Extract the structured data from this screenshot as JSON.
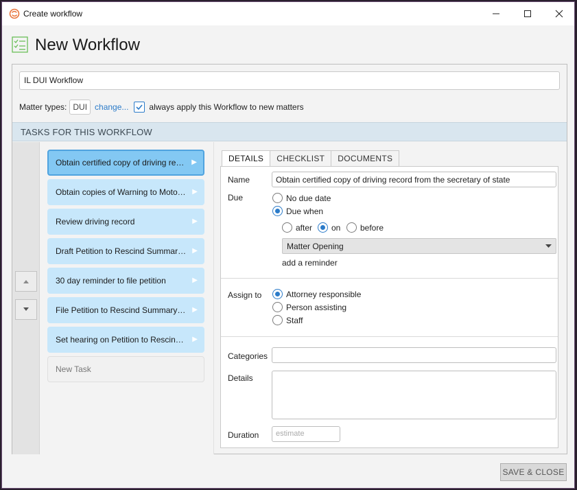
{
  "window": {
    "title": "Create workflow",
    "controls": [
      "minimize",
      "maximize",
      "close"
    ]
  },
  "header": {
    "title": "New Workflow",
    "icon": "checklist-icon"
  },
  "workflow": {
    "name": "IL DUI Workflow",
    "matter_types_label": "Matter types:",
    "matter_type_value": "DUI",
    "change_link": "change...",
    "always_apply_label": "always apply this Workflow to new matters",
    "always_apply_checked": true
  },
  "tasks_section": {
    "heading": "TASKS FOR THIS WORKFLOW",
    "tasks": [
      {
        "label": "Obtain certified copy of driving rec...",
        "selected": true
      },
      {
        "label": "Obtain copies of Warning to Motori...",
        "selected": false
      },
      {
        "label": "Review driving record",
        "selected": false
      },
      {
        "label": "Draft Petition to Rescind Summary S...",
        "selected": false
      },
      {
        "label": "30 day reminder to file petition",
        "selected": false
      },
      {
        "label": "File Petition to Rescind Summary Su...",
        "selected": false
      },
      {
        "label": "Set hearing on Petition to Rescind S...",
        "selected": false
      }
    ],
    "new_task_label": "New Task"
  },
  "tabs": [
    {
      "label": "DETAILS",
      "active": true
    },
    {
      "label": "CHECKLIST",
      "active": false
    },
    {
      "label": "DOCUMENTS",
      "active": false
    }
  ],
  "details": {
    "name_label": "Name",
    "name_value": "Obtain certified copy of driving record from the secretary of state",
    "due_label": "Due",
    "due_options": [
      {
        "label": "No due date",
        "selected": false
      },
      {
        "label": "Due when",
        "selected": true
      }
    ],
    "timing_options": [
      {
        "label": "after",
        "selected": false
      },
      {
        "label": "on",
        "selected": true
      },
      {
        "label": "before",
        "selected": false
      }
    ],
    "event_select": "Matter Opening",
    "add_reminder": "add a reminder",
    "assign_label": "Assign to",
    "assign_options": [
      {
        "label": "Attorney responsible",
        "selected": true
      },
      {
        "label": "Person assisting",
        "selected": false
      },
      {
        "label": "Staff",
        "selected": false
      }
    ],
    "categories_label": "Categories",
    "categories_value": "",
    "details_label": "Details",
    "details_value": "",
    "duration_label": "Duration",
    "duration_placeholder": "estimate"
  },
  "footer": {
    "save_label": "SAVE & CLOSE"
  },
  "colors": {
    "accent": "#2b7bc9",
    "task_bg": "#c7e7fb",
    "task_selected_bg": "#83c8f3",
    "section_bar": "#d9e6ef"
  }
}
